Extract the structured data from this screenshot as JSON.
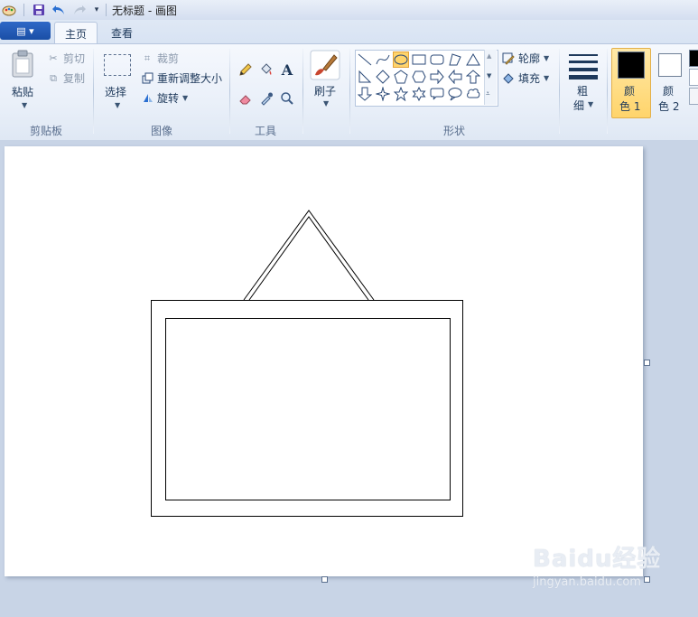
{
  "window": {
    "title": "无标题 - 画图"
  },
  "tabs": {
    "file_menu": "▤ ▾",
    "home": "主页",
    "view": "查看"
  },
  "clipboard": {
    "paste": "粘贴",
    "cut": "剪切",
    "copy": "复制",
    "group": "剪贴板"
  },
  "image": {
    "select": "选择",
    "crop": "裁剪",
    "resize": "重新调整大小",
    "rotate": "旋转",
    "group": "图像"
  },
  "tools": {
    "group": "工具",
    "text_tool": "A"
  },
  "brushes": {
    "label": "刷子"
  },
  "shapes": {
    "outline": "轮廓",
    "fill": "填充",
    "group": "形状"
  },
  "size": {
    "line1": "粗",
    "line2": "细"
  },
  "colors": {
    "color1_line1": "颜",
    "color1_line2": "色 1",
    "color2_line1": "颜",
    "color2_line2": "色 2",
    "color1_value": "#000000",
    "color2_value": "#ffffff"
  },
  "watermark": {
    "brand": "Baidu经验",
    "url": "jingyan.baidu.com"
  }
}
